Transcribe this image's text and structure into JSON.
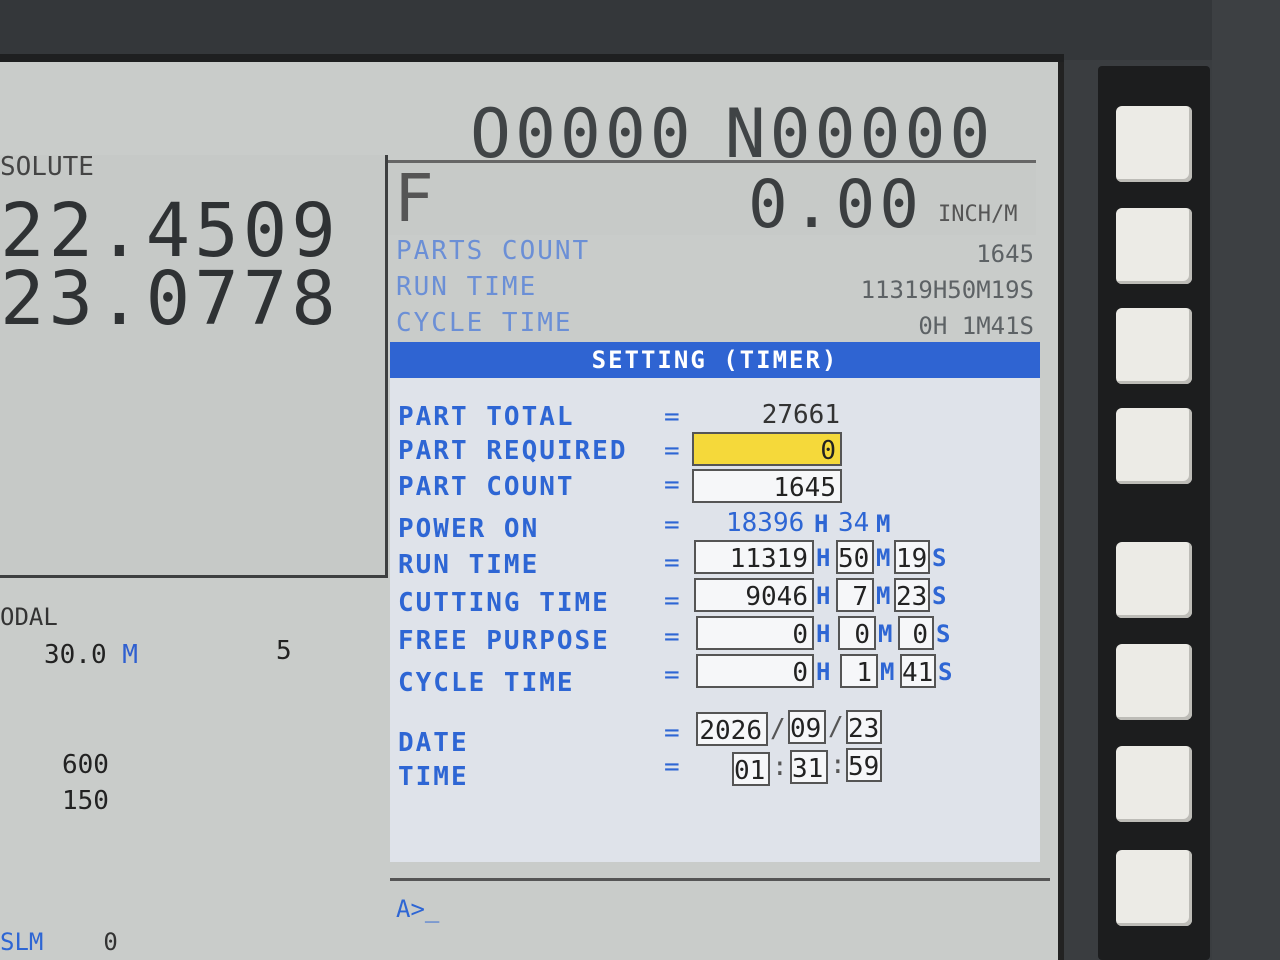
{
  "header": {
    "program": "O0000",
    "sequence": "N00000"
  },
  "position": {
    "title": "SOLUTE",
    "axis1": "22.4509",
    "axis2": "23.0778"
  },
  "modal": {
    "title": "ODAL",
    "feed_value": "30.0",
    "feed_unit": "M",
    "right_value": "5",
    "val1": "600",
    "val2": "150",
    "slm_label": "SLM",
    "slm_value": "0"
  },
  "feed": {
    "letter": "F",
    "value": "0.00",
    "unit": "INCH/M"
  },
  "counters": {
    "parts_count_label": "PARTS COUNT",
    "parts_count_value": "1645",
    "run_time_label": "RUN TIME",
    "run_time_value": "11319H50M19S",
    "cycle_time_label": "CYCLE TIME",
    "cycle_time_value": "0H 1M41S"
  },
  "setting": {
    "title": "SETTING (TIMER)",
    "part_total_label": "PART TOTAL",
    "part_total_value": "27661",
    "part_required_label": "PART REQUIRED",
    "part_required_value": "0",
    "part_count_label": "PART COUNT",
    "part_count_value": "1645",
    "power_on_label": "POWER ON",
    "power_on_h": "18396",
    "power_on_m": "34",
    "run_time_label": "RUN TIME",
    "run_time_h": "11319",
    "run_time_m": "50",
    "run_time_s": "19",
    "cutting_time_label": "CUTTING TIME",
    "cutting_time_h": "9046",
    "cutting_time_m": "7",
    "cutting_time_s": "23",
    "free_purpose_label": "FREE PURPOSE",
    "free_purpose_h": "0",
    "free_purpose_m": "0",
    "free_purpose_s": "0",
    "cycle_time_label": "CYCLE TIME",
    "cycle_time_h": "0",
    "cycle_time_m": "1",
    "cycle_time_s": "41",
    "date_label": "DATE",
    "date_y": "2026",
    "date_m": "09",
    "date_d": "23",
    "time_label": "TIME",
    "time_h": "01",
    "time_m": "31",
    "time_s": "59",
    "eq": "=",
    "unit_h": "H",
    "unit_m": "M",
    "unit_s": "S",
    "date_sep": "/",
    "time_sep": ":"
  },
  "prompt": "A>_"
}
